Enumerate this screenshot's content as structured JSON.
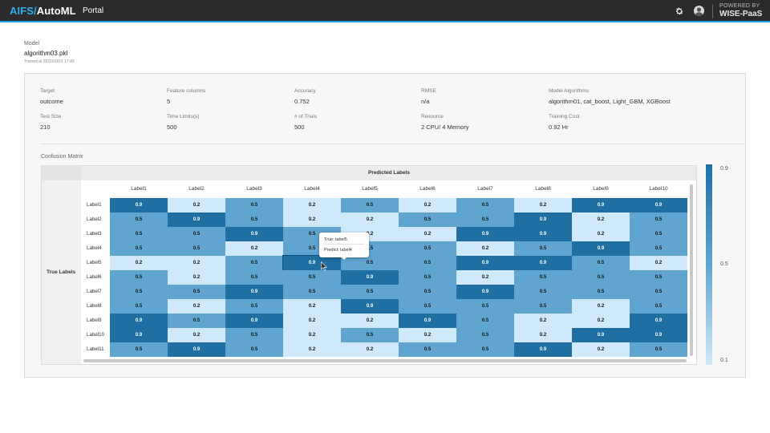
{
  "header": {
    "brand_part1": "AIFS/",
    "brand_part2": "AutoML",
    "portal": "Portal",
    "powered_by": "POWERED BY",
    "wise": "WISE-PaaS",
    "icons": [
      "gear-icon",
      "avatar-icon"
    ]
  },
  "model": {
    "label": "Model",
    "name": "algorithm03.pkl",
    "trained": "Trained at 2021/03/21 17:43"
  },
  "info": [
    {
      "key": "Target",
      "value": "outcome"
    },
    {
      "key": "Feature columns",
      "value": "5"
    },
    {
      "key": "Accuracy",
      "value": "0.752"
    },
    {
      "key": "RMSE",
      "value": "n/a"
    },
    {
      "key": "Model Algorithms",
      "value": "algorithm01, cat_boost, Light_GBM, XGBoost"
    },
    {
      "key": "Test Size",
      "value": "210"
    },
    {
      "key": "Time Limits(s)",
      "value": "500"
    },
    {
      "key": "# of Trials",
      "value": "500"
    },
    {
      "key": "Resource",
      "value": "2 CPU/ 4 Memory"
    },
    {
      "key": "Training Cost",
      "value": "0.92 Hr"
    }
  ],
  "matrix": {
    "title": "Confusion Matrix",
    "predicted_header": "Predicted Labels",
    "true_header": "True Labels",
    "columns": [
      "Label1",
      "Label2",
      "Label3",
      "Label4",
      "Label5",
      "Label6",
      "Label7",
      "Label8",
      "Label9",
      "Label10"
    ],
    "rows": [
      "Label1",
      "Label2",
      "Label3",
      "Label4",
      "Label5",
      "Label6",
      "Label7",
      "Label8",
      "Label9",
      "Label10",
      "Label11"
    ],
    "values": [
      [
        "0.9",
        "0.2",
        "0.5",
        "0.2",
        "0.5",
        "0.2",
        "0.5",
        "0.2",
        "0.9",
        "0.9"
      ],
      [
        "0.5",
        "0.9",
        "0.5",
        "0.2",
        "0.2",
        "0.5",
        "0.5",
        "0.9",
        "0.2",
        "0.5"
      ],
      [
        "0.5",
        "0.5",
        "0.9",
        "0.5",
        "0.2",
        "0.2",
        "0.9",
        "0.9",
        "0.2",
        "0.5"
      ],
      [
        "0.5",
        "0.5",
        "0.2",
        "0.5",
        "0.5",
        "0.5",
        "0.2",
        "0.5",
        "0.9",
        "0.5"
      ],
      [
        "0.2",
        "0.2",
        "0.5",
        "0.9",
        "0.5",
        "0.5",
        "0.9",
        "0.9",
        "0.5",
        "0.2"
      ],
      [
        "0.5",
        "0.2",
        "0.5",
        "0.5",
        "0.9",
        "0.5",
        "0.2",
        "0.5",
        "0.5",
        "0.5"
      ],
      [
        "0.5",
        "0.5",
        "0.9",
        "0.5",
        "0.5",
        "0.5",
        "0.9",
        "0.5",
        "0.5",
        "0.5"
      ],
      [
        "0.5",
        "0.2",
        "0.5",
        "0.2",
        "0.9",
        "0.5",
        "0.5",
        "0.5",
        "0.2",
        "0.5"
      ],
      [
        "0.9",
        "0.5",
        "0.9",
        "0.2",
        "0.2",
        "0.9",
        "0.5",
        "0.2",
        "0.2",
        "0.9"
      ],
      [
        "0.9",
        "0.2",
        "0.5",
        "0.2",
        "0.5",
        "0.2",
        "0.5",
        "0.2",
        "0.9",
        "0.9"
      ],
      [
        "0.5",
        "0.9",
        "0.5",
        "0.2",
        "0.2",
        "0.5",
        "0.5",
        "0.9",
        "0.2",
        "0.5"
      ]
    ],
    "tooltip": {
      "true": "True: label5",
      "predict": "Predict: label4"
    },
    "selected": {
      "row": 4,
      "col": 3
    }
  },
  "legend": {
    "max": "0.9",
    "mid": "0.5",
    "min": "0.1"
  },
  "colors": {
    "high": "#1f6fa3",
    "mid": "#5fa5cf",
    "low": "#cfe9fa",
    "accent": "#1aa0e0"
  }
}
